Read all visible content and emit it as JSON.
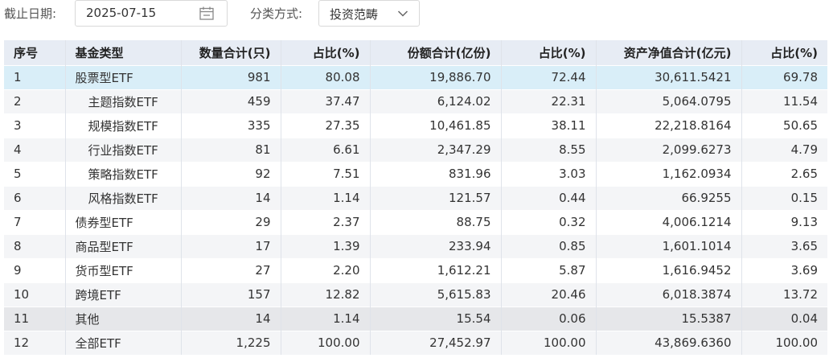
{
  "filters": {
    "date_label": "截止日期:",
    "date_value": "2025-07-15",
    "category_label": "分类方式:",
    "category_value": "投资范畴"
  },
  "table": {
    "headers": [
      "序号",
      "基金类型",
      "数量合计(只)",
      "占比(%)",
      "份额合计(亿份)",
      "占比(%)",
      "资产净值合计(亿元)",
      "占比(%)"
    ],
    "rows": [
      [
        "1",
        "股票型ETF",
        "981",
        "80.08",
        "19,886.70",
        "72.44",
        "30,611.5421",
        "69.78"
      ],
      [
        "2",
        "主题指数ETF",
        "459",
        "37.47",
        "6,124.02",
        "22.31",
        "5,064.0795",
        "11.54"
      ],
      [
        "3",
        "规模指数ETF",
        "335",
        "27.35",
        "10,461.85",
        "38.11",
        "22,218.8164",
        "50.65"
      ],
      [
        "4",
        "行业指数ETF",
        "81",
        "6.61",
        "2,347.29",
        "8.55",
        "2,099.6273",
        "4.79"
      ],
      [
        "5",
        "策略指数ETF",
        "92",
        "7.51",
        "831.96",
        "3.03",
        "1,162.0934",
        "2.65"
      ],
      [
        "6",
        "风格指数ETF",
        "14",
        "1.14",
        "121.57",
        "0.44",
        "66.9255",
        "0.15"
      ],
      [
        "7",
        "债券型ETF",
        "29",
        "2.37",
        "88.75",
        "0.32",
        "4,006.1214",
        "9.13"
      ],
      [
        "8",
        "商品型ETF",
        "17",
        "1.39",
        "233.94",
        "0.85",
        "1,601.1014",
        "3.65"
      ],
      [
        "9",
        "货币型ETF",
        "27",
        "2.20",
        "1,612.21",
        "5.87",
        "1,616.9452",
        "3.69"
      ],
      [
        "10",
        "跨境ETF",
        "157",
        "12.82",
        "5,615.83",
        "20.46",
        "6,018.3874",
        "13.72"
      ],
      [
        "11",
        "其他",
        "14",
        "1.14",
        "15.54",
        "0.06",
        "15.5387",
        "0.04"
      ],
      [
        "12",
        "全部ETF",
        "1,225",
        "100.00",
        "27,452.97",
        "100.00",
        "43,869.6360",
        "100.00"
      ]
    ]
  }
}
